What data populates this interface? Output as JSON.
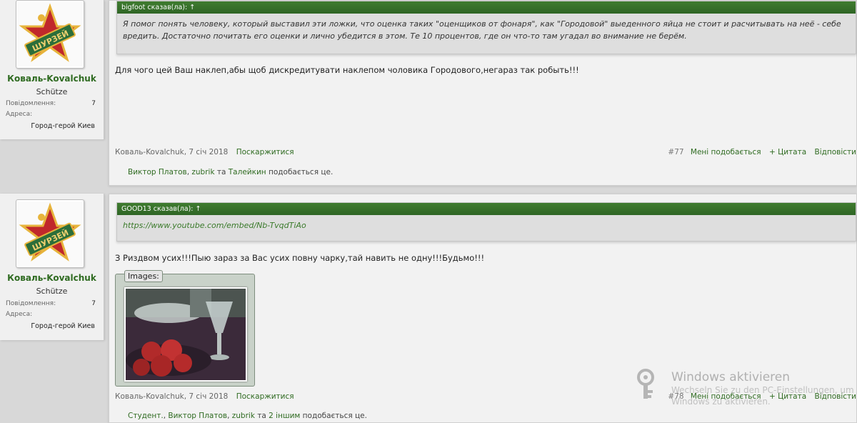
{
  "posts": [
    {
      "user": {
        "name": "Коваль-Kovalchuk",
        "title": "Schütze",
        "posts_label": "Повідомлення:",
        "posts_value": "7",
        "address_label": "Адреса:",
        "address_value": "Город-герой Киев"
      },
      "quote": {
        "head": "bigfoot сказав(ла): ↑",
        "body": "Я помог понять человеку, который выставил эти ложки, что оценка таких \"оценщиков от фонаря\", как \"Городовой\" выеденного яйца не стоит и расчитывать на неё - себе вредить. Достаточно почитать его оценки и лично убедится в этом. Те 10 процентов, где он что-то там угадал во внимание не берём."
      },
      "text": "Для чого цей Ваш наклеп,абы щоб дискредитувати наклепом чоловика Городового,негараз так робыть!!!",
      "meta": {
        "author": "Коваль-Kovalchuk, 7 січ 2018",
        "report": "Поскаржитися"
      },
      "actions": {
        "num": "#77",
        "like": "Мені подобається",
        "quote": "+ Цитата",
        "reply": "Відповісти"
      },
      "likes": {
        "users": [
          "Виктор Платов",
          "zubrik"
        ],
        "sep1": ", ",
        "and": " та ",
        "last": "Талейкин",
        "suffix": " подобається це."
      }
    },
    {
      "user": {
        "name": "Коваль-Kovalchuk",
        "title": "Schütze",
        "posts_label": "Повідомлення:",
        "posts_value": "7",
        "address_label": "Адреса:",
        "address_value": "Город-герой Киев"
      },
      "quote": {
        "head": "GOOD13 сказав(ла): ↑",
        "body": "https://www.youtube.com/embed/Nb-TvqdTiAo"
      },
      "text": "З Риздвом усих!!!Пыю зараз за Вас усих повну чарку,тай навить не одну!!!Будьмо!!!",
      "attachment": {
        "label": "Images:"
      },
      "meta": {
        "author": "Коваль-Kovalchuk, 7 січ 2018",
        "report": "Поскаржитися"
      },
      "actions": {
        "num": "#78",
        "like": "Мені подобається",
        "quote": "+ Цитата",
        "reply": "Відповісти"
      },
      "likes": {
        "users": [
          "Студент.",
          "Виктор Платов",
          "zubrik"
        ],
        "and": " та ",
        "last": "2 іншим",
        "suffix": " подобається це."
      }
    }
  ],
  "watermark": {
    "title": "Windows aktivieren",
    "line1": "Wechseln Sie zu den PC-Einstellungen, um",
    "line2": "Windows zu aktivieren."
  },
  "colors": {
    "accent": "#2f6b21",
    "quote_head": "#3f7c2f",
    "background": "#d8d8d8"
  },
  "icons": [
    "avatar-star-badge-icon",
    "key-icon"
  ]
}
